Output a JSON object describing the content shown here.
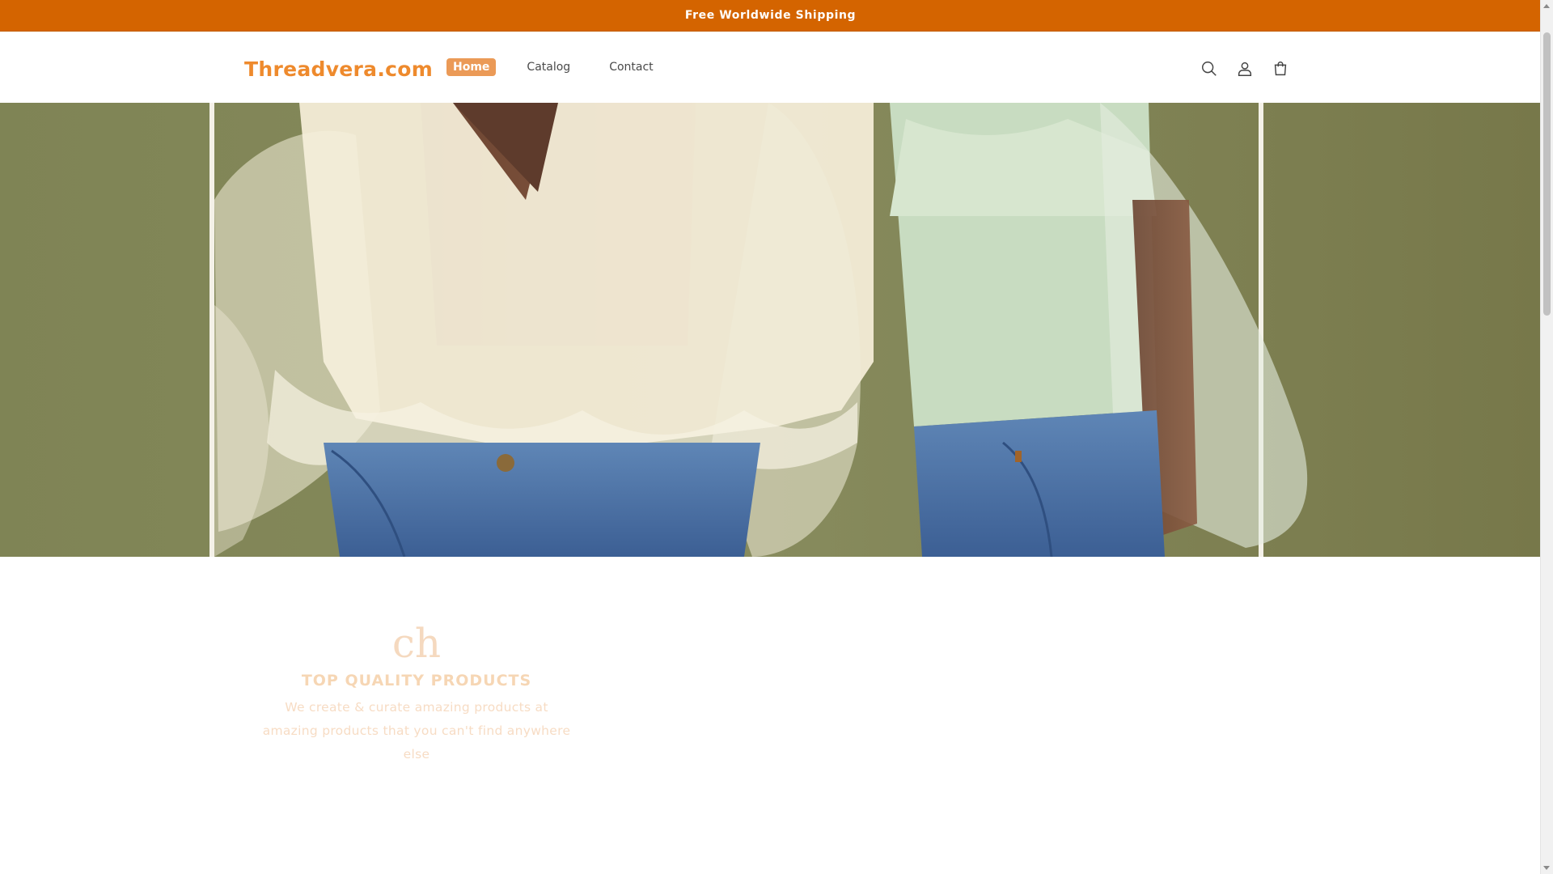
{
  "announcement": {
    "text": "Free Worldwide Shipping"
  },
  "header": {
    "logo": "Threadvera.com",
    "nav": [
      {
        "label": "Home",
        "active": true
      },
      {
        "label": "Catalog",
        "active": false
      },
      {
        "label": "Contact",
        "active": false
      }
    ],
    "icons": [
      "search-icon",
      "account-icon",
      "cart-icon"
    ]
  },
  "hero": {
    "image": "two-models-sheer-organza-blouses-denim"
  },
  "feature": {
    "icon_text": "ch",
    "title": "TOP QUALITY PRODUCTS",
    "text": "We create & curate amazing products at amazing products that you can't find anywhere else"
  },
  "colors": {
    "announcement_bg": "#d46400",
    "logo": "#ee8a2d",
    "nav_active_bg": "#eb9a57",
    "hero_bg": "#7c8050"
  }
}
